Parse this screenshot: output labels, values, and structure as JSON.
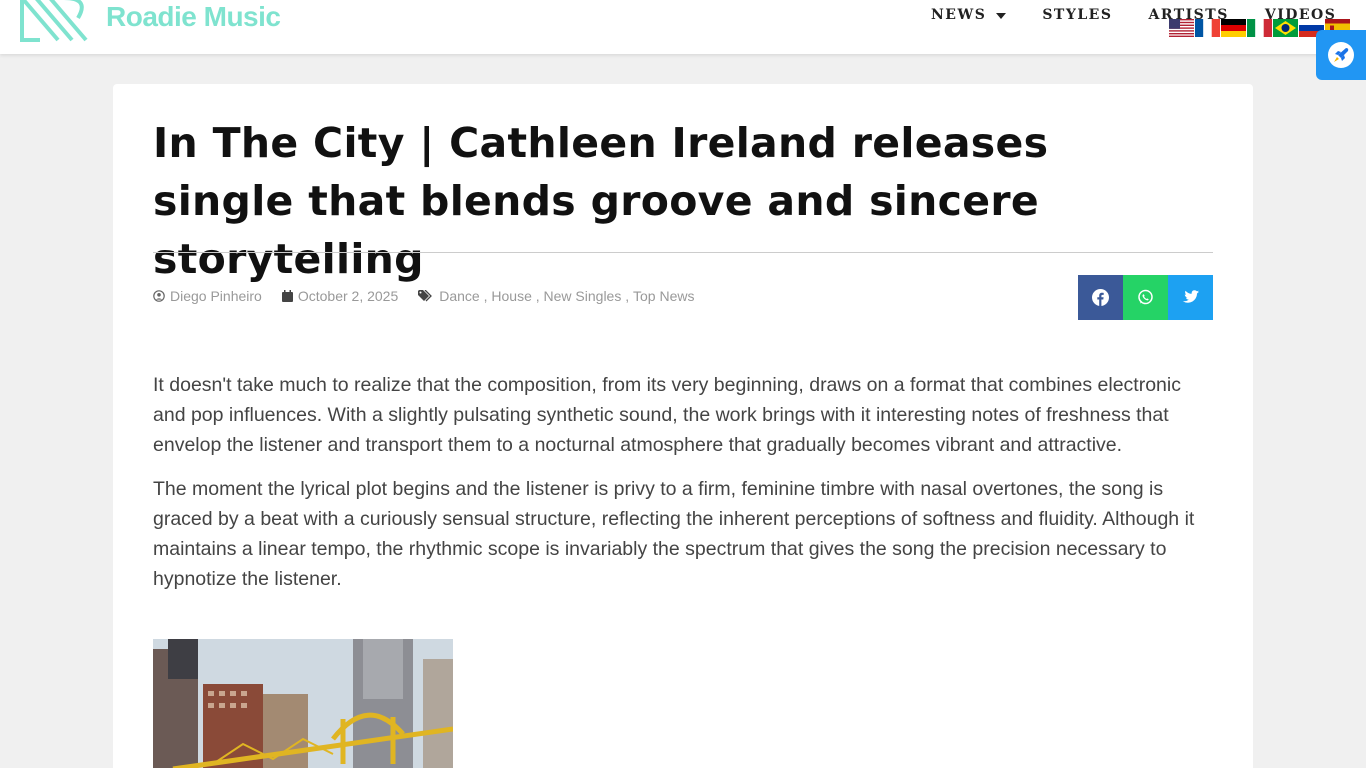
{
  "header": {
    "logo_text": "Roadie Music",
    "nav": [
      {
        "label": "NEWS",
        "has_dropdown": true
      },
      {
        "label": "STYLES",
        "has_dropdown": false
      },
      {
        "label": "ARTISTS",
        "has_dropdown": false
      },
      {
        "label": "VIDEOS",
        "has_dropdown": false
      }
    ],
    "flags": [
      "en",
      "fr",
      "de",
      "it",
      "pt",
      "ru",
      "es"
    ],
    "accent_color": "#7fe3cf"
  },
  "article": {
    "title": "In The City | Cathleen Ireland releases single that blends groove and sincere storytelling",
    "author": "Diego Pinheiro",
    "date": "October 2, 2025",
    "categories": [
      "Dance ,",
      "House ,",
      "New Singles ,",
      "Top News"
    ],
    "share_icons": [
      "facebook-icon",
      "whatsapp-icon",
      "twitter-icon"
    ],
    "paragraphs": [
      "It doesn't take much to realize that the composition, from its very beginning, draws on a format that combines electronic and pop influences. With a slightly pulsating synthetic sound, the work brings with it interesting notes of freshness that envelop the listener and transport them to a nocturnal atmosphere that gradually becomes vibrant and attractive.",
      "The moment the lyrical plot begins and the listener is privy to a firm, feminine timbre with nasal overtones, the song is graced by a beat with a curiously sensual structure, reflecting the inherent perceptions of softness and fluidity. Although it maintains a linear tempo, the rhythmic scope is invariably the spectrum that gives the song the precision necessary to hypnotize the listener."
    ]
  }
}
